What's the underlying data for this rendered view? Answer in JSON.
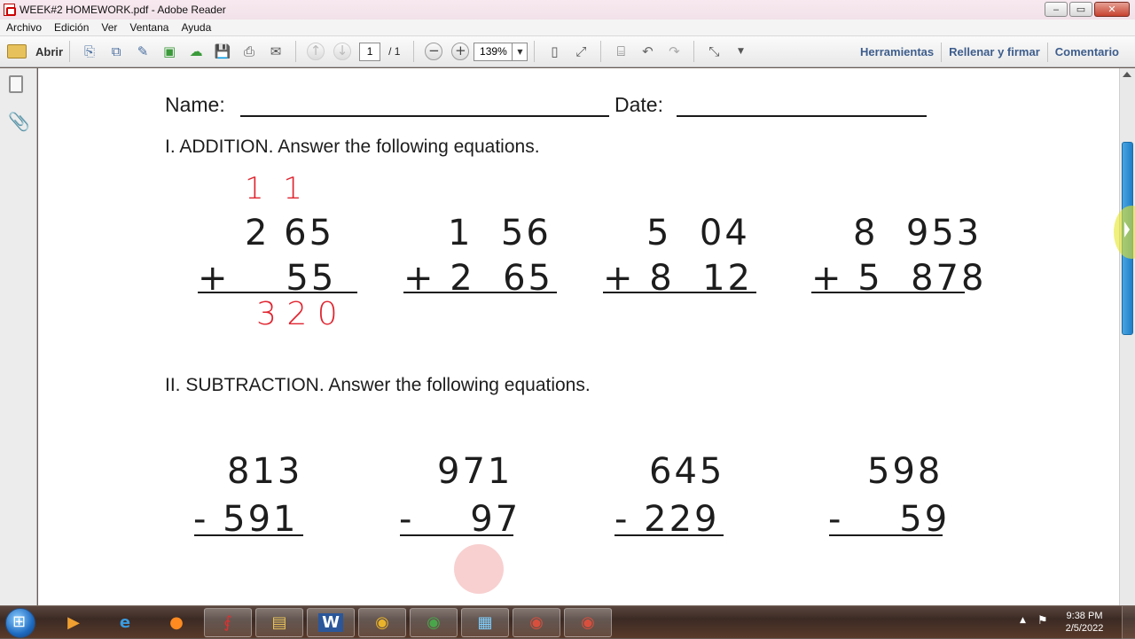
{
  "window": {
    "title": "WEEK#2 HOMEWORK.pdf - Adobe Reader",
    "buttons": [
      "‒",
      "▭",
      "✕"
    ]
  },
  "menu": [
    "Archivo",
    "Edición",
    "Ver",
    "Ventana",
    "Ayuda"
  ],
  "toolbar": {
    "open_label": "Abrir",
    "page_current": "1",
    "page_total": "/ 1",
    "zoom": "139%",
    "tools_label": "Herramientas",
    "sign_label": "Rellenar y firmar",
    "comment_label": "Comentario"
  },
  "document": {
    "name_label": "Name:",
    "date_label": "Date:",
    "section1": "I. ADDITION. Answer the following equations.",
    "section2": "II. SUBTRACTION. Answer the following equations.",
    "addition": [
      {
        "top": "2 65",
        "bottom": "+    55",
        "carry": "1  1",
        "answer": "3 2 0"
      },
      {
        "top": "1  56",
        "bottom": "+ 2  65",
        "carry": "",
        "answer": ""
      },
      {
        "top": "5  04",
        "bottom": "+ 8  12",
        "carry": "",
        "answer": ""
      },
      {
        "top": "8  953",
        "bottom": "+ 5  878",
        "carry": "",
        "answer": ""
      }
    ],
    "subtraction": [
      {
        "top": "813",
        "bottom": "- 591"
      },
      {
        "top": "971",
        "bottom": "-    97"
      },
      {
        "top": "645",
        "bottom": "- 229"
      },
      {
        "top": "598",
        "bottom": "-    59"
      }
    ],
    "accent_color": "#e0242f"
  },
  "taskbar": {
    "apps": [
      "media-player",
      "internet-explorer",
      "firefox",
      "adobe-reader",
      "file-explorer",
      "word",
      "chrome",
      "chrome-r",
      "video-editor",
      "chrome-c",
      "chrome-m"
    ],
    "time": "9:38 PM",
    "date": "2/5/2022"
  }
}
